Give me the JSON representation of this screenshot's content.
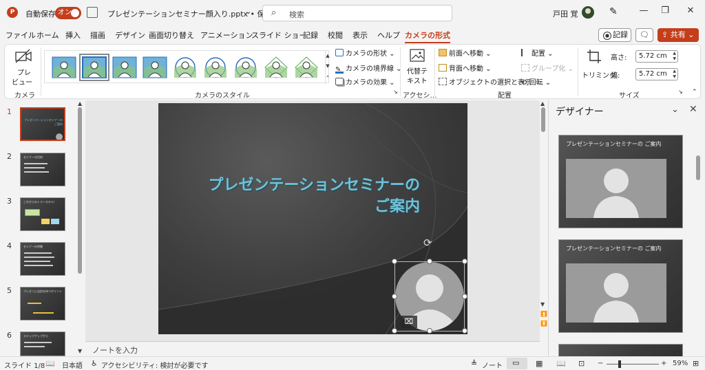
{
  "titlebar": {
    "autosave_label": "自動保存",
    "autosave_state": "オン",
    "doc_title": "プレゼンテーションセミナー顔入り.pptx • 保存中…",
    "search_placeholder": "検索",
    "user_name": "戸田 覚"
  },
  "tabs": [
    "ファイル",
    "ホーム",
    "挿入",
    "描画",
    "デザイン",
    "画面切り替え",
    "アニメーション",
    "スライド ショー",
    "記録",
    "校閲",
    "表示",
    "ヘルプ",
    "カメラの形式"
  ],
  "active_tab": "カメラの形式",
  "tab_actions": {
    "record": "記録",
    "share": "共有"
  },
  "ribbon": {
    "camera_group": {
      "preview_l1": "プレ",
      "preview_l2": "ビュー",
      "label": "カメラ"
    },
    "styles_group": {
      "shape": "カメラの形状",
      "border": "カメラの境界線",
      "effects": "カメラの効果",
      "label": "カメラのスタイル"
    },
    "access_group": {
      "alt_l1": "代替テ",
      "alt_l2": "キスト",
      "label": "アクセシ…"
    },
    "arrange_group": {
      "bring_forward": "前面へ移動",
      "send_backward": "背面へ移動",
      "selection_pane": "オブジェクトの選択と表示",
      "align": "配置",
      "group": "グループ化",
      "rotate": "回転",
      "label": "配置"
    },
    "size_group": {
      "crop": "トリミング",
      "height_label": "高さ:",
      "height_value": "5.72 cm",
      "width_label": "幅:",
      "width_value": "5.72 cm",
      "label": "サイズ"
    }
  },
  "slides": [
    {
      "num": "1",
      "title": "プレゼンテーションセミナーのご案内"
    },
    {
      "num": "2",
      "title": "セミナーの目的"
    },
    {
      "num": "3",
      "title": "これからのトラースキル！"
    },
    {
      "num": "4",
      "title": "セミナーの特徴"
    },
    {
      "num": "5",
      "title": "プレゼンに自信を持つポイント"
    },
    {
      "num": "6",
      "title": "ステップアップから"
    }
  ],
  "current_slide": {
    "title_line1": "プレゼンテーションセミナーの",
    "title_line2": "ご案内"
  },
  "notes_placeholder": "ノートを入力",
  "designer": {
    "title": "デザイナー",
    "cards": [
      {
        "title": "プレゼンテーションセミナーの ご案内"
      },
      {
        "title": "プレゼンテーションセミナーの ご案内"
      }
    ]
  },
  "statusbar": {
    "slide_position": "スライド 1/8",
    "language": "日本語",
    "accessibility": "アクセシビリティ: 検討が必要です",
    "notes": "ノート",
    "zoom": "59%"
  },
  "colors": {
    "accent": "#c43e1c",
    "title_text": "#6ec3da",
    "slide_bg": "#3e3e3e"
  }
}
